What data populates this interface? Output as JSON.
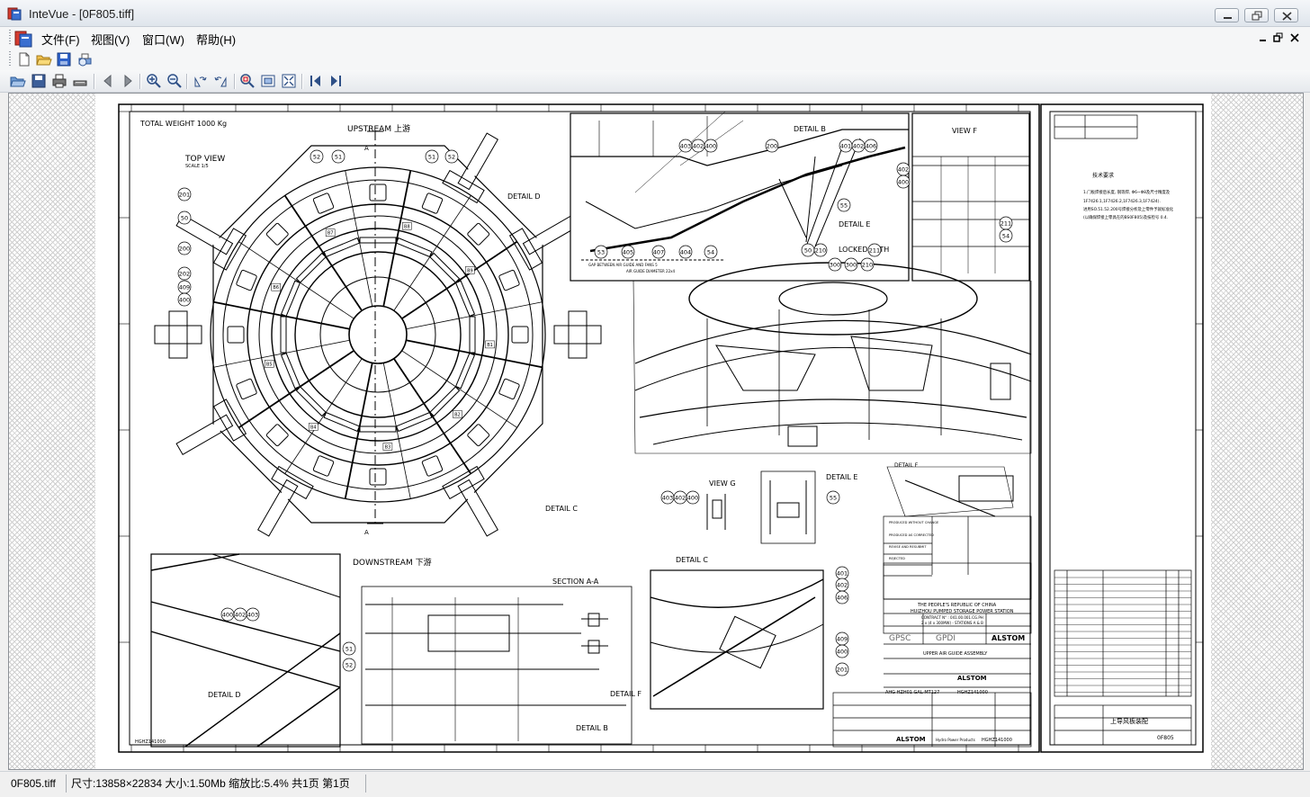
{
  "window": {
    "title": "InteVue - [0F805.tiff]"
  },
  "menu": {
    "items": [
      "文件(F)",
      "视图(V)",
      "窗口(W)",
      "帮助(H)"
    ]
  },
  "toolbar_primary": {
    "icons": [
      "new-document-icon",
      "open-folder-icon",
      "save-icon",
      "print-preview-icon"
    ]
  },
  "toolbar_viewer": {
    "icons": [
      "open-folder-icon",
      "save-icon",
      "print-icon",
      "scanner-icon",
      "previous-icon",
      "next-icon",
      "zoom-in-icon",
      "zoom-out-icon",
      "rotate-left-icon",
      "rotate-right-icon",
      "zoom-area-icon",
      "fit-window-icon",
      "fit-width-icon",
      "first-page-icon",
      "last-page-icon"
    ]
  },
  "drawing": {
    "total_weight": "TOTAL WEIGHT 1000 Kg",
    "top_view": "TOP VIEW",
    "top_view_scale": "SCALE 1/5",
    "upstream": "UPSTREAM 上游",
    "downstream": "DOWNSTREAM 下游",
    "section_marker": "A",
    "detail_a": "DETAIL D",
    "detail_c": "DETAIL C",
    "detail_b": "DETAIL B",
    "detail_e": "DETAIL E",
    "detail_f": "DETAIL F",
    "view_f": "VIEW F",
    "view_g": "VIEW G",
    "section_aa": "SECTION A-A",
    "locked_with": "LOCKED WITH",
    "air_gap_label": "GAP BETWEEN AIR GUIDE AND FANS 5",
    "air_guide_diameter": "AIR GUIDE DIAMETER 22x4",
    "tech_req_title": "技术要求",
    "tech_req_lines": [
      "1.门板焊接后长度, 钢等焊, Φ6~Φ8及尺寸精度及",
      "1F7426.1,1F7426.2,1F7426.3,1F7424).",
      "进用SO.51.52.200号焊接分析及上零件予就标准化",
      "(以确保焊接上零具在的BS0F805)及技检号 0.4."
    ],
    "client_line1": "THE PEOPLE'S REPUBLIC OF CHINA",
    "client_line2": "HUIZHOU PUMPED STORAGE POWER STATION",
    "client_line3": "CONTRACT N° : 041.00.001.CG.PH",
    "client_line4": "2 x (4 x 300MW) - STATIONS A & B",
    "gpsc": "GPSC",
    "gpdi": "GPDI",
    "alstom": "ALSTOM",
    "assembly_title": "UPPER AIR GUIDE ASSEMBLY",
    "drawing_no_1": "AHG HZH01 GAL-MT127",
    "drawing_no_2": "HGHZ141000",
    "sheet_id": "0F805",
    "chinese_title": "上导风板装配",
    "hydro": "Hydro Power Products",
    "checklist": [
      "PRODUCED WITHOUT CHANGE",
      "PRODUCED AS CORRECTED",
      "REVISE AND RESUBMIT",
      "REJECTED"
    ],
    "bubbles_top": [
      "52",
      "51",
      "51",
      "52",
      "201",
      "50",
      "200",
      "202",
      "409",
      "400"
    ],
    "bubbles_detail_b": [
      "403",
      "402",
      "400",
      "200",
      "401",
      "402",
      "406",
      "55",
      "402",
      "400",
      "53",
      "405",
      "407",
      "404",
      "54",
      "50",
      "210",
      "211",
      "300",
      "300",
      "210",
      "211",
      "54",
      "53"
    ],
    "bubbles_detail_c": [
      "401",
      "402",
      "406",
      "409",
      "400",
      "201"
    ],
    "bubbles_detail_d": [
      "400",
      "402",
      "403",
      "51",
      "52"
    ],
    "bubbles_view_g": [
      "403",
      "402",
      "400"
    ],
    "bubbles_detail_e": [
      "55"
    ],
    "panel_tags": [
      "B1",
      "B2",
      "B3",
      "B4",
      "B5",
      "B6",
      "B7",
      "B8",
      "B9"
    ]
  },
  "statusbar": {
    "filename": "0F805.tiff",
    "info": "尺寸:13858×22834 大小:1.50Mb 缩放比:5.4% 共1页 第1页"
  }
}
